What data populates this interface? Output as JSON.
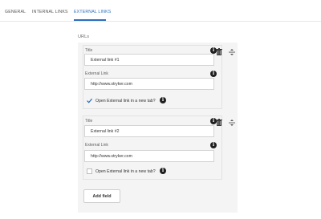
{
  "tabs": [
    {
      "label": "GENERAL",
      "active": false
    },
    {
      "label": "INTERNAL LINKS",
      "active": false
    },
    {
      "label": "EXTERNAL LINKS",
      "active": true
    }
  ],
  "section_label": "URLs",
  "items": [
    {
      "title_label": "Title",
      "title_value": "External  link #1",
      "link_label": "External Link",
      "link_value": "http://www.stryker.com",
      "checkbox_label": "Open External link in a new tab?",
      "checked": true
    },
    {
      "title_label": "Title",
      "title_value": "External link #2",
      "link_label": "External Link",
      "link_value": "http://www.stryker.com",
      "checkbox_label": "Open External link in a new tab?",
      "checked": false
    }
  ],
  "add_button_label": "Add field",
  "colors": {
    "accent": "#2c6fbf",
    "panel": "#f4f4f4"
  }
}
